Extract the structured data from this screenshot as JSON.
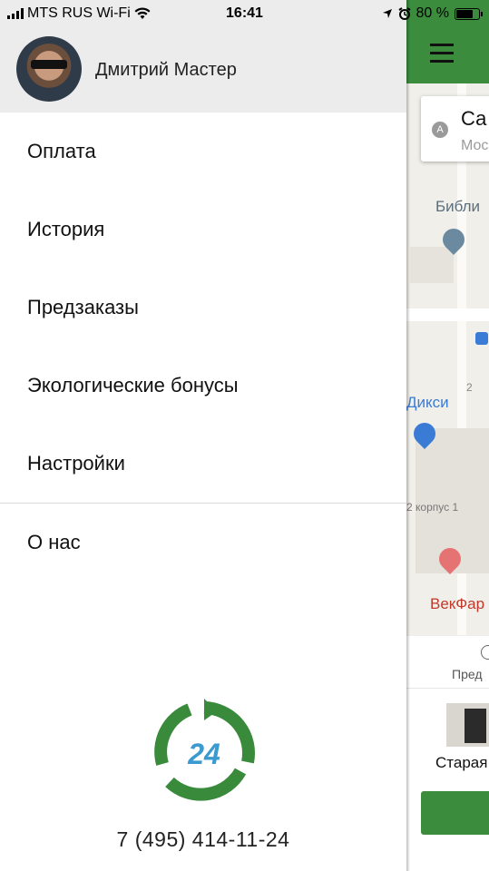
{
  "status_bar": {
    "carrier": "MTS RUS Wi-Fi",
    "time": "16:41",
    "battery": "80 %",
    "battery_level": 0.8
  },
  "drawer": {
    "profile": {
      "name": "Дмитрий Мастер"
    },
    "menu": [
      {
        "label": "Оплата"
      },
      {
        "label": "История"
      },
      {
        "label": "Предзаказы"
      },
      {
        "label": "Экологические бонусы"
      },
      {
        "label": "Настройки"
      },
      {
        "label": "О нас"
      }
    ],
    "logo_text": "24",
    "phone": "7 (495) 414-11-24"
  },
  "background_screen": {
    "address": {
      "marker": "A",
      "main": "Са",
      "sub": "Мос"
    },
    "map_labels": {
      "library": "Библи",
      "shop": "Дикси",
      "building": "2 корпус 1",
      "pharmacy": "ВекФар",
      "number": "2"
    },
    "tab_label": "Пред",
    "card_label": "Старая",
    "card_label_left": "",
    "accent_color": "#3c8c3e"
  }
}
